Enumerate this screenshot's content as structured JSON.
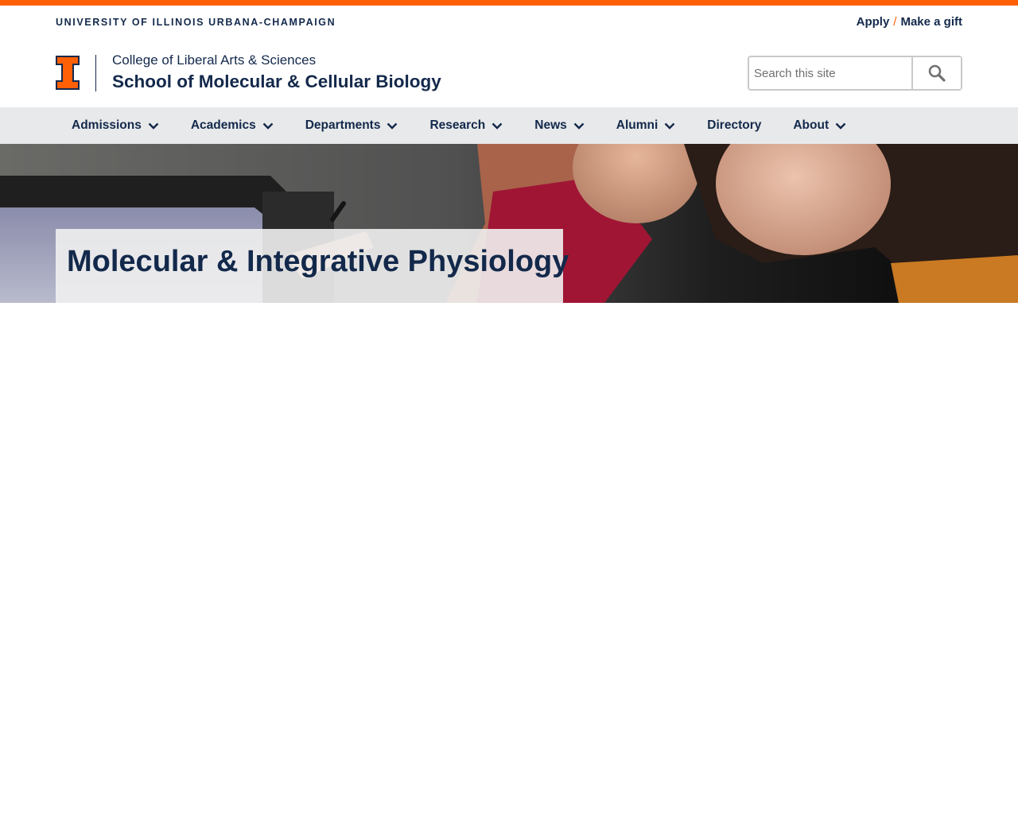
{
  "colors": {
    "orange": "#ff5f05",
    "navy": "#13294b",
    "nav_bg": "#e8e9ea"
  },
  "header": {
    "university_name": "UNIVERSITY OF ILLINOIS URBANA-CHAMPAIGN",
    "util_links": {
      "apply": "Apply",
      "separator": "/",
      "gift": "Make a gift"
    },
    "college": "College of Liberal Arts & Sciences",
    "school": "School of Molecular & Cellular Biology",
    "logo_icon": "block-i-icon"
  },
  "search": {
    "placeholder": "Search this site",
    "value": "",
    "icon": "search-icon"
  },
  "nav": {
    "items": [
      {
        "label": "Admissions",
        "has_dropdown": true
      },
      {
        "label": "Academics",
        "has_dropdown": true
      },
      {
        "label": "Departments",
        "has_dropdown": true
      },
      {
        "label": "Research",
        "has_dropdown": true
      },
      {
        "label": "News",
        "has_dropdown": true
      },
      {
        "label": "Alumni",
        "has_dropdown": true
      },
      {
        "label": "Directory",
        "has_dropdown": false
      },
      {
        "label": "About",
        "has_dropdown": true
      }
    ]
  },
  "hero": {
    "title": "Molecular & Integrative Physiology"
  }
}
